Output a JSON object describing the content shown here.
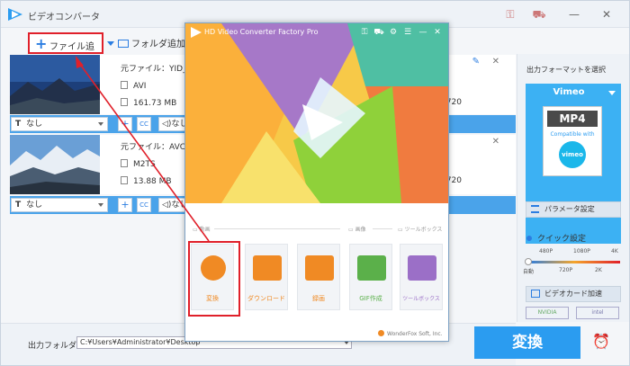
{
  "app": {
    "title": "ビデオコンバータ"
  },
  "toolbar": {
    "add_file": "ファイル追加",
    "add_folder": "フォルダ追加"
  },
  "files": [
    {
      "source": "元ファイル：YID_",
      "format": "AVI",
      "size": "161.73 MB",
      "right_value": "720",
      "subtitle": "なし",
      "audio": "なし"
    },
    {
      "source": "元ファイル：AVCH",
      "format": "M2TS",
      "size": "13.88 MB",
      "right_value": "720",
      "subtitle": "なし",
      "audio": "なし"
    }
  ],
  "bottom": {
    "output_label": "出力フォルダ：",
    "output_path": "C:¥Users¥Administrator¥Desktop",
    "convert": "変換"
  },
  "right_panel": {
    "title": "出力フォーマットを選択",
    "format_name": "Vimeo",
    "format_card_main": "MP4",
    "format_card_compat": "Compatible with",
    "format_card_logo": "vimeo",
    "param_button": "パラメータ設定",
    "quick_label": "クイック設定",
    "slider_top": [
      "480P",
      "1080P",
      "4K"
    ],
    "slider_bottom": [
      "自動",
      "720P",
      "2K"
    ],
    "gpu_button": "ビデオカード加速",
    "gpu_logos": [
      "NVIDIA",
      "intel"
    ]
  },
  "popup": {
    "title": "HD Video Converter Factory Pro",
    "sections": {
      "video": "動画",
      "image": "画像",
      "tools": "ツールボックス"
    },
    "tiles": [
      {
        "label": "変換",
        "color": "#f08a24"
      },
      {
        "label": "ダウンロード",
        "color": "#f08a24"
      },
      {
        "label": "録画",
        "color": "#f08a24"
      },
      {
        "label": "GIF作成",
        "color": "#5bb04a"
      },
      {
        "label": "ツールボックス",
        "color": "#9b6fc7"
      }
    ],
    "footer": "WonderFox Soft, Inc."
  },
  "colors": {
    "accent": "#2b9cf0",
    "highlight": "#e0202a",
    "sub_bar": "#4aa3ea"
  }
}
